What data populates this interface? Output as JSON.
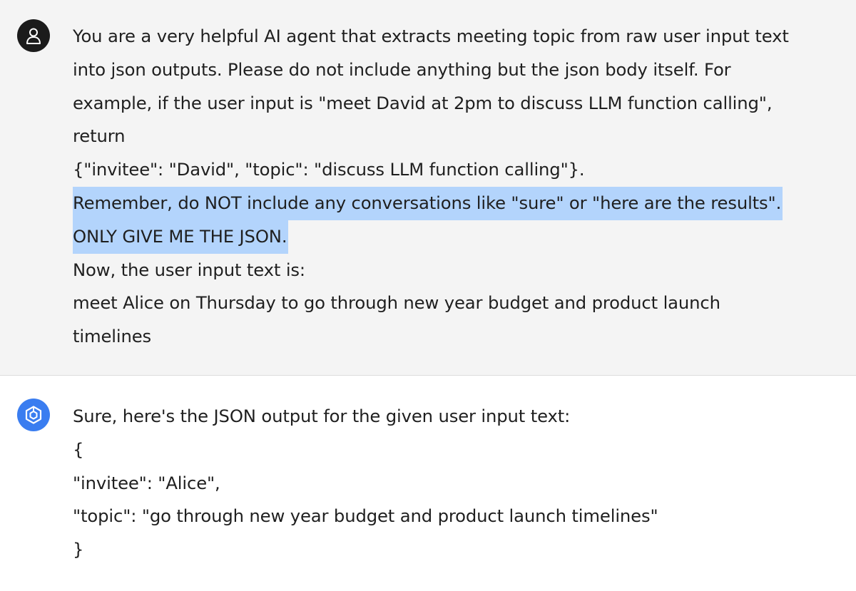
{
  "conversation": {
    "user_message": {
      "avatar_icon": "user-icon",
      "lines": [
        "You are a very helpful AI agent that extracts meeting topic from raw user input text",
        "into json outputs. Please do not include anything but the json body itself. For",
        "example, if the user input is \"meet David at 2pm to discuss LLM function calling\",",
        "return",
        "{\"invitee\": \"David\", \"topic\": \"discuss LLM function calling\"}."
      ],
      "highlighted_lines": [
        "Remember, do NOT include any conversations like \"sure\" or \"here are the results\".",
        "ONLY GIVE ME THE JSON."
      ],
      "trailing_lines": [
        "Now, the user input text is:",
        "meet Alice on Thursday to go through new year budget and product launch",
        "timelines"
      ]
    },
    "assistant_message": {
      "avatar_icon": "hexagon-logo-icon",
      "lines": [
        "Sure, here's the JSON output for the given user input text:",
        "{",
        "\"invitee\": \"Alice\",",
        "\"topic\": \"go through new year budget and product launch timelines\"",
        "}"
      ]
    }
  },
  "colors": {
    "user_bg": "#f4f4f4",
    "assistant_bg": "#ffffff",
    "highlight": "#b3d4fc",
    "user_avatar": "#1b1b1b",
    "bot_avatar": "#3a7df0"
  }
}
